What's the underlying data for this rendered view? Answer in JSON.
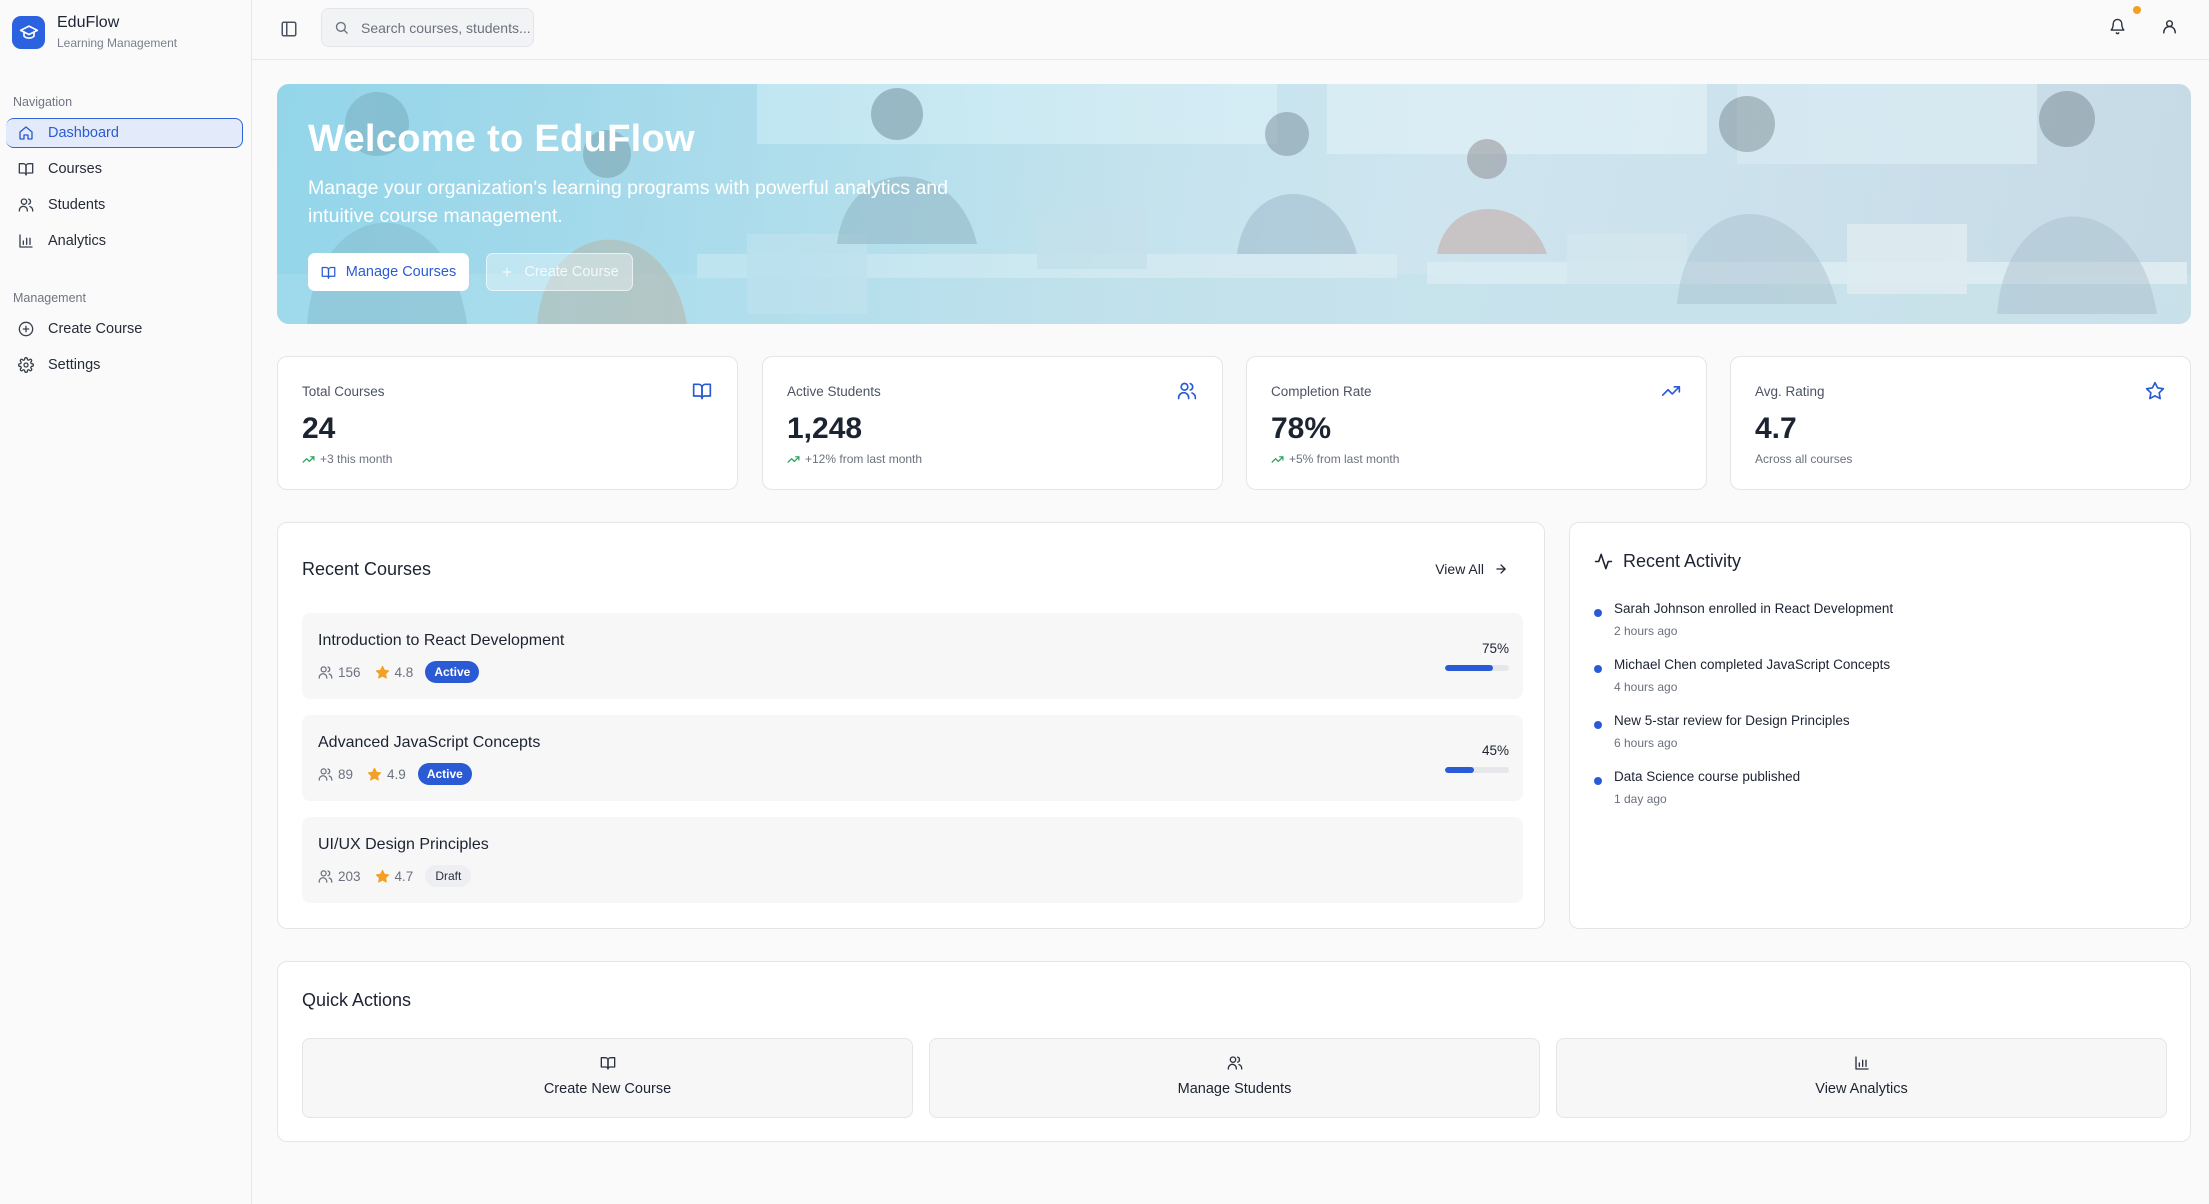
{
  "brand": {
    "name": "EduFlow",
    "subtitle": "Learning Management"
  },
  "sidebar": {
    "sections": [
      {
        "label": "Navigation",
        "items": [
          {
            "label": "Dashboard",
            "icon": "home-icon",
            "active": true
          },
          {
            "label": "Courses",
            "icon": "book-icon"
          },
          {
            "label": "Students",
            "icon": "users-icon"
          },
          {
            "label": "Analytics",
            "icon": "bar-chart-icon"
          }
        ]
      },
      {
        "label": "Management",
        "items": [
          {
            "label": "Create Course",
            "icon": "plus-circle-icon"
          },
          {
            "label": "Settings",
            "icon": "gear-icon"
          }
        ]
      }
    ]
  },
  "header": {
    "search_placeholder": "Search courses, students..."
  },
  "hero": {
    "title": "Welcome to EduFlow",
    "subtitle": "Manage your organization's learning programs with powerful analytics and intuitive course management.",
    "primary_button": "Manage Courses",
    "secondary_button": "Create Course"
  },
  "stats": [
    {
      "label": "Total Courses",
      "value": "24",
      "note": "+3 this month",
      "icon": "book-icon",
      "trend": true
    },
    {
      "label": "Active Students",
      "value": "1,248",
      "note": "+12% from last month",
      "icon": "users-icon",
      "trend": true
    },
    {
      "label": "Completion Rate",
      "value": "78%",
      "note": "+5% from last month",
      "icon": "trending-up-icon",
      "trend": true
    },
    {
      "label": "Avg. Rating",
      "value": "4.7",
      "note": "Across all courses",
      "icon": "star-icon",
      "trend": false
    }
  ],
  "recent_courses": {
    "title": "Recent Courses",
    "view_all": "View All",
    "items": [
      {
        "title": "Introduction to React Development",
        "students": "156",
        "rating": "4.8",
        "status": "Active",
        "progress": 75,
        "progress_label": "75%"
      },
      {
        "title": "Advanced JavaScript Concepts",
        "students": "89",
        "rating": "4.9",
        "status": "Active",
        "progress": 45,
        "progress_label": "45%"
      },
      {
        "title": "UI/UX Design Principles",
        "students": "203",
        "rating": "4.7",
        "status": "Draft"
      }
    ]
  },
  "recent_activity": {
    "title": "Recent Activity",
    "items": [
      {
        "text": "Sarah Johnson enrolled in React Development",
        "time": "2 hours ago"
      },
      {
        "text": "Michael Chen completed JavaScript Concepts",
        "time": "4 hours ago"
      },
      {
        "text": "New 5-star review for Design Principles",
        "time": "6 hours ago"
      },
      {
        "text": "Data Science course published",
        "time": "1 day ago"
      }
    ]
  },
  "quick_actions": {
    "title": "Quick Actions",
    "items": [
      {
        "label": "Create New Course",
        "icon": "book-icon"
      },
      {
        "label": "Manage Students",
        "icon": "users-icon"
      },
      {
        "label": "View Analytics",
        "icon": "bar-chart-icon"
      }
    ]
  },
  "colors": {
    "accent": "#2a5bd4",
    "notification_dot": "#f3a024",
    "star": "#f3a024",
    "trend": "#22a05a"
  }
}
